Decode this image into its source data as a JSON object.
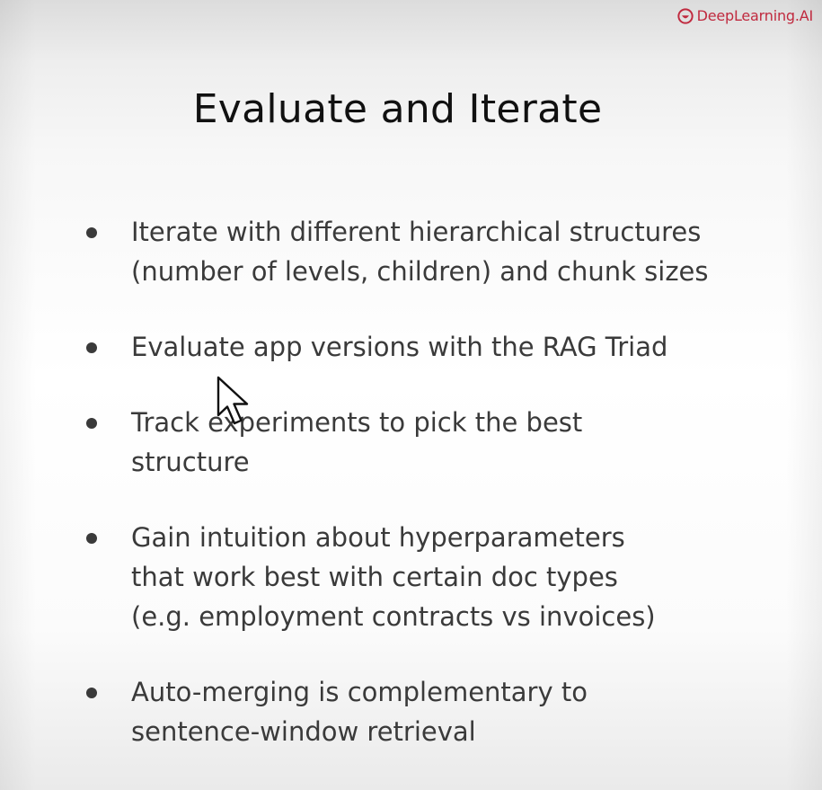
{
  "brand": {
    "name": "DeepLearning.AI",
    "icon": "deeplearning-logo-icon",
    "color": "#c02a3f"
  },
  "slide": {
    "title": "Evaluate and Iterate",
    "bullets": [
      {
        "text": "Iterate with different hierarchical structures\n(number of levels, children) and chunk sizes"
      },
      {
        "text": "Evaluate app versions with the RAG Triad"
      },
      {
        "text": "Track experiments to pick the best\nstructure"
      },
      {
        "text": "Gain intuition about hyperparameters\nthat work best with certain doc types\n(e.g. employment contracts vs invoices)"
      },
      {
        "text": "Auto-merging is complementary to\nsentence-window retrieval"
      }
    ]
  },
  "cursor": {
    "icon": "mouse-pointer-icon"
  }
}
